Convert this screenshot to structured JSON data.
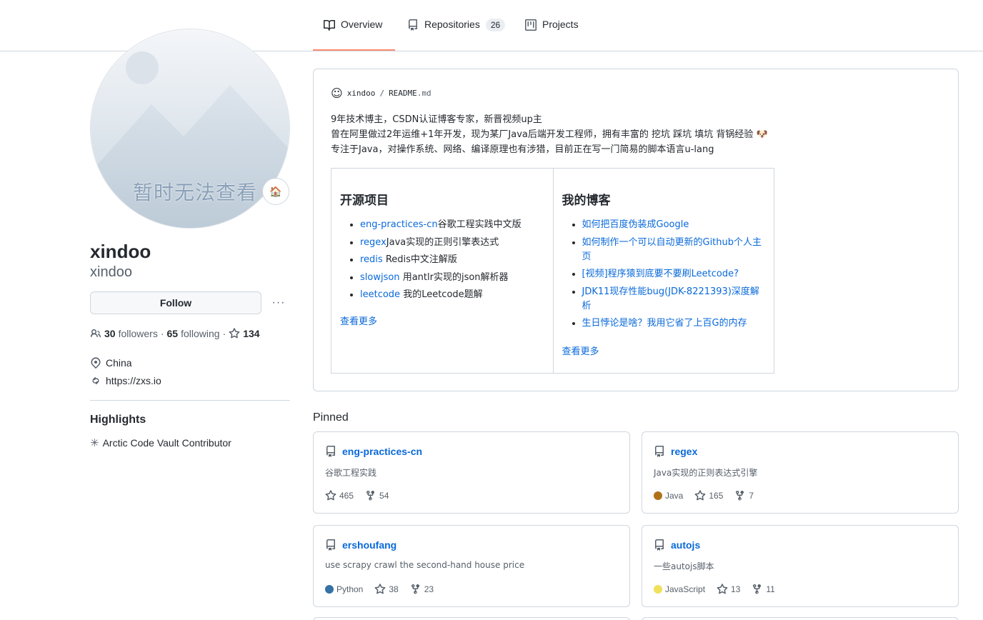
{
  "tabs": [
    {
      "label": "Overview",
      "icon": "book-icon",
      "active": true
    },
    {
      "label": "Repositories",
      "icon": "repo-icon",
      "count": "26"
    },
    {
      "label": "Projects",
      "icon": "project-icon"
    }
  ],
  "profile": {
    "avatar_caption": "暂时无法查看",
    "status_emoji": "🏠",
    "name": "xindoo",
    "login": "xindoo",
    "follow_label": "Follow",
    "more_label": "···",
    "followers_count": "30",
    "followers_label": "followers",
    "dot1": "·",
    "following_count": "65",
    "following_label": "following",
    "dot2": "·",
    "stars_count": "134",
    "location": "China",
    "website": "https://zxs.io"
  },
  "highlights": {
    "title": "Highlights",
    "item": "Arctic Code Vault Contributor"
  },
  "readme": {
    "owner": "xindoo",
    "slash": "/",
    "file_base": "README",
    "file_ext": ".md",
    "intro_line1": "9年技术博主，CSDN认证博客专家，新晋视频up主",
    "intro_line2": "曾在阿里做过2年运维+1年开发，现为某厂Java后端开发工程师，拥有丰富的 挖坑 踩坑 填坑 背锅经验",
    "intro_line2_emoji": "🐶",
    "intro_line3": "专注于Java，对操作系统、网络、编译原理也有涉猎，目前正在写一门简易的脚本语言u-lang",
    "projects": {
      "heading": "开源项目",
      "items": [
        {
          "link": "eng-practices-cn",
          "text": "谷歌工程实践中文版"
        },
        {
          "link": "regex",
          "text": "Java实现的正则引擎表达式"
        },
        {
          "link": "redis",
          "text": " Redis中文注解版"
        },
        {
          "link": "slowjson",
          "text": " 用antlr实现的json解析器"
        },
        {
          "link": "leetcode",
          "text": " 我的Leetcode题解"
        }
      ],
      "more": "查看更多"
    },
    "blogs": {
      "heading": "我的博客",
      "items": [
        "如何把百度伪装成Google",
        "如何制作一个可以自动更新的Github个人主页",
        "[视频]程序猿到底要不要刷Leetcode?",
        "JDK11现存性能bug(JDK-8221393)深度解析",
        "生日悖论是啥？我用它省了上百G的内存"
      ],
      "more": "查看更多"
    }
  },
  "pinned": {
    "title": "Pinned",
    "repos": [
      {
        "name": "eng-practices-cn",
        "desc": "谷歌工程实践",
        "lang": "",
        "lang_color": "",
        "stars": "465",
        "forks": "54"
      },
      {
        "name": "regex",
        "desc": "Java实现的正则表达式引擎",
        "lang": "Java",
        "lang_color": "#b07219",
        "stars": "165",
        "forks": "7"
      },
      {
        "name": "ershoufang",
        "desc": "use scrapy crawl the second-hand house price",
        "lang": "Python",
        "lang_color": "#3572A5",
        "stars": "38",
        "forks": "23"
      },
      {
        "name": "autojs",
        "desc": "一些autojs脚本",
        "lang": "JavaScript",
        "lang_color": "#f1e05a",
        "stars": "13",
        "forks": "11"
      }
    ]
  }
}
